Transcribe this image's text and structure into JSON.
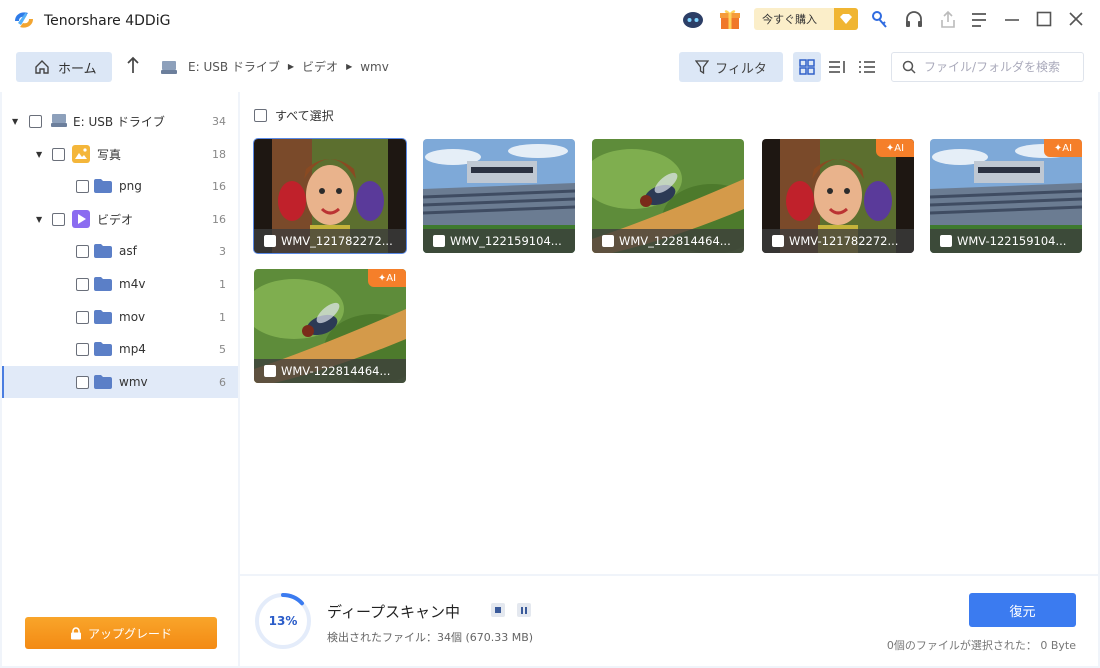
{
  "app": {
    "title": "Tenorshare 4DDiG"
  },
  "titlebar": {
    "buy_label": "今すぐ購入"
  },
  "toolbar": {
    "home_label": "ホーム",
    "breadcrumb": [
      "E: USB ドライブ",
      "ビデオ",
      "wmv"
    ],
    "filter_label": "フィルタ",
    "search_placeholder": "ファイル/フォルダを検索"
  },
  "sidebar": {
    "items": [
      {
        "label": "E: USB ドライブ",
        "count": "34"
      },
      {
        "label": "写真",
        "count": "18"
      },
      {
        "label": "png",
        "count": "16"
      },
      {
        "label": "ビデオ",
        "count": "16"
      },
      {
        "label": "asf",
        "count": "3"
      },
      {
        "label": "m4v",
        "count": "1"
      },
      {
        "label": "mov",
        "count": "1"
      },
      {
        "label": "mp4",
        "count": "5"
      },
      {
        "label": "wmv",
        "count": "6"
      }
    ],
    "upgrade_label": "アップグレード"
  },
  "main": {
    "select_all_label": "すべて選択",
    "files": [
      {
        "name": "WMV_121782272...",
        "ai": false,
        "art": "kid"
      },
      {
        "name": "WMV_122159104...",
        "ai": false,
        "art": "stadium"
      },
      {
        "name": "WMV_122814464...",
        "ai": false,
        "art": "fly"
      },
      {
        "name": "WMV-121782272...",
        "ai": true,
        "art": "kid"
      },
      {
        "name": "WMV-122159104...",
        "ai": true,
        "art": "stadium"
      },
      {
        "name": "WMV-122814464...",
        "ai": true,
        "art": "fly"
      }
    ],
    "ai_badge": "AI"
  },
  "status": {
    "progress_percent": 13,
    "progress_label": "13%",
    "scan_title": "ディープスキャン中",
    "scan_detail": "検出されたファイル：34個 (670.33 MB)",
    "restore_label": "復元",
    "selection_info": "0個のファイルが選択された： 0 Byte"
  },
  "colors": {
    "accent": "#3b7bf0",
    "upgrade": "#f38a14",
    "ai_badge": "#f57f2a"
  }
}
